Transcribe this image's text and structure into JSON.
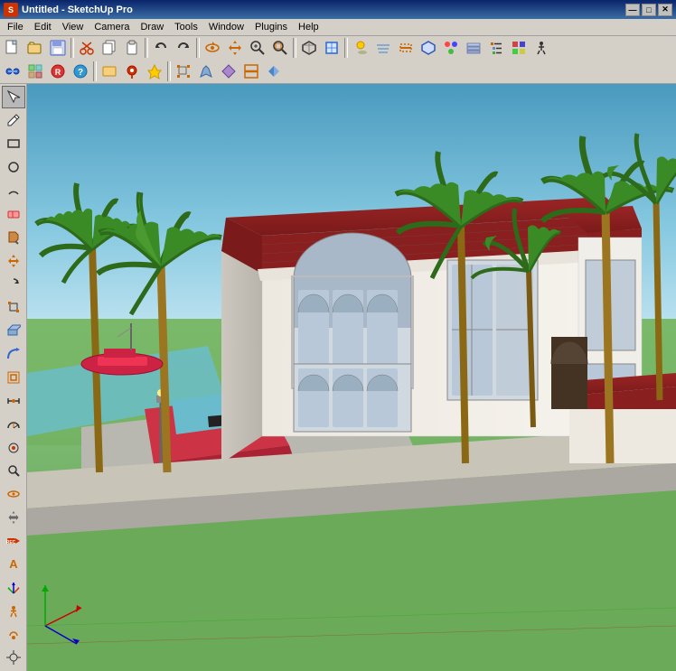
{
  "window": {
    "title": "Untitled - SketchUp Pro",
    "icon_label": "SU"
  },
  "title_bar": {
    "minimize_label": "—",
    "maximize_label": "□",
    "close_label": "✕"
  },
  "menu": {
    "items": [
      "File",
      "Edit",
      "View",
      "Camera",
      "Draw",
      "Tools",
      "Window",
      "Plugins",
      "Help"
    ]
  },
  "toolbar1": {
    "buttons": [
      {
        "icon": "📄",
        "name": "new"
      },
      {
        "icon": "📂",
        "name": "open"
      },
      {
        "icon": "💾",
        "name": "save"
      },
      {
        "icon": "🖨️",
        "name": "print"
      },
      {
        "icon": "✂️",
        "name": "cut"
      },
      {
        "icon": "📋",
        "name": "copy"
      },
      {
        "icon": "📌",
        "name": "paste"
      },
      {
        "icon": "↩",
        "name": "undo"
      },
      {
        "icon": "↪",
        "name": "redo"
      },
      {
        "icon": "🔘",
        "name": "select"
      },
      {
        "icon": "🔲",
        "name": "component"
      },
      {
        "icon": "🪣",
        "name": "paint"
      },
      {
        "icon": "🗑️",
        "name": "erase"
      },
      {
        "icon": "📏",
        "name": "tape"
      },
      {
        "icon": "📐",
        "name": "dimensions"
      },
      {
        "icon": "✏️",
        "name": "text"
      },
      {
        "icon": "🏹",
        "name": "protractor"
      },
      {
        "icon": "🔧",
        "name": "axes"
      },
      {
        "icon": "🔁",
        "name": "orbit"
      },
      {
        "icon": "✋",
        "name": "pan"
      },
      {
        "icon": "🔍",
        "name": "zoom"
      },
      {
        "icon": "🔎",
        "name": "zoom-extents"
      },
      {
        "icon": "🪟",
        "name": "prev-view"
      },
      {
        "icon": "📦",
        "name": "iso"
      },
      {
        "icon": "🖱️",
        "name": "walk"
      },
      {
        "icon": "📸",
        "name": "scene"
      },
      {
        "icon": "☀️",
        "name": "shadows"
      },
      {
        "icon": "🌫️",
        "name": "fog"
      },
      {
        "icon": "🎨",
        "name": "materials"
      },
      {
        "icon": "🔷",
        "name": "styles"
      },
      {
        "icon": "📊",
        "name": "layers"
      }
    ]
  },
  "toolbar2": {
    "buttons": [
      {
        "icon": "🏠",
        "name": "home"
      },
      {
        "icon": "⭕",
        "name": "circle"
      },
      {
        "icon": "®",
        "name": "rect"
      },
      {
        "icon": "❓",
        "name": "help"
      },
      {
        "icon": "🔴",
        "name": "red-dot"
      },
      {
        "icon": "💡",
        "name": "lamp"
      },
      {
        "icon": "📍",
        "name": "pin"
      },
      {
        "icon": "↕️",
        "name": "move"
      },
      {
        "icon": "🔺",
        "name": "tri"
      },
      {
        "icon": "◈",
        "name": "diamond"
      },
      {
        "icon": "⚙️",
        "name": "gear"
      },
      {
        "icon": "🔗",
        "name": "link"
      }
    ]
  },
  "left_toolbar": {
    "buttons": [
      {
        "icon": "↖",
        "name": "select",
        "active": true
      },
      {
        "icon": "✏",
        "name": "pencil"
      },
      {
        "icon": "⬜",
        "name": "rectangle"
      },
      {
        "icon": "⬡",
        "name": "polygon"
      },
      {
        "icon": "○",
        "name": "circle"
      },
      {
        "icon": "↩",
        "name": "arc"
      },
      {
        "icon": "✂",
        "name": "erase"
      },
      {
        "icon": "🪣",
        "name": "paint"
      },
      {
        "icon": "↔",
        "name": "move"
      },
      {
        "icon": "↩",
        "name": "rotate"
      },
      {
        "icon": "📐",
        "name": "scale"
      },
      {
        "icon": "⊞",
        "name": "pushpull"
      },
      {
        "icon": "→",
        "name": "follow"
      },
      {
        "icon": "⊕",
        "name": "offset"
      },
      {
        "icon": "📏",
        "name": "tape"
      },
      {
        "icon": "∠",
        "name": "angle"
      },
      {
        "icon": "👁",
        "name": "lookat"
      },
      {
        "icon": "🔍",
        "name": "zoom"
      },
      {
        "icon": "⊙",
        "name": "orbit"
      },
      {
        "icon": "✋",
        "name": "pan"
      },
      {
        "icon": "▣",
        "name": "rec"
      },
      {
        "icon": "A",
        "name": "text-tool"
      },
      {
        "icon": "★",
        "name": "ruby"
      },
      {
        "icon": "🔁",
        "name": "walkthrough"
      },
      {
        "icon": "👁",
        "name": "look-around"
      },
      {
        "icon": "⊕",
        "name": "position"
      }
    ]
  },
  "colors": {
    "sky_top": "#5aa0c8",
    "sky_bottom": "#b8dced",
    "ground": "#6aaa5a",
    "titlebar_start": "#0a246a",
    "titlebar_end": "#3a6ea5",
    "toolbar_bg": "#d4d0c8",
    "building_wall": "#f5f0e8",
    "roof_color": "#8b2020",
    "grass": "#5a9a4a"
  }
}
